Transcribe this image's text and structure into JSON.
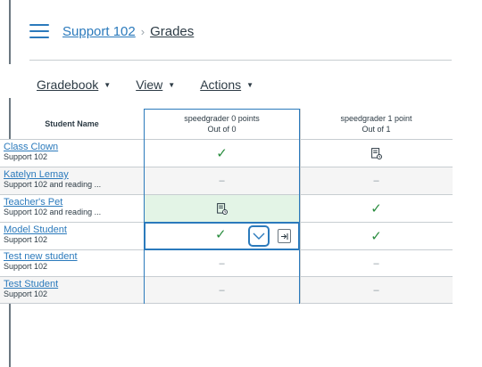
{
  "breadcrumb": {
    "course": "Support 102",
    "separator": "›",
    "current": "Grades"
  },
  "toolbar": {
    "menus": [
      {
        "label": "Gradebook",
        "caret": "▼"
      },
      {
        "label": "View",
        "caret": "▼"
      },
      {
        "label": "Actions",
        "caret": "▼"
      }
    ]
  },
  "grid": {
    "name_header": "Student Name",
    "columns": [
      {
        "title": "speedgrader 0 points",
        "subtitle": "Out of 0"
      },
      {
        "title": "speedgrader 1 point",
        "subtitle": "Out of 1"
      }
    ],
    "rows": [
      {
        "name": "Class Clown",
        "section": "Support 102",
        "grades": [
          "check",
          "pending"
        ]
      },
      {
        "name": "Katelyn Lemay",
        "section": "Support 102 and reading ...",
        "grades": [
          "dash",
          "dash"
        ]
      },
      {
        "name": "Teacher's Pet",
        "section": "Support 102 and reading ...",
        "grades": [
          "pending",
          "check"
        ]
      },
      {
        "name": "Model Student",
        "section": "Support 102",
        "grades": [
          "check",
          "check"
        ]
      },
      {
        "name": "Test new student",
        "section": "Support 102",
        "grades": [
          "dash",
          "dash"
        ]
      },
      {
        "name": "Test Student",
        "section": "Support 102",
        "grades": [
          "dash",
          "dash"
        ]
      }
    ],
    "symbols": {
      "check": "✓",
      "dash": "–"
    }
  },
  "colors": {
    "link": "#2b7abc",
    "check": "#2a8d3f",
    "row_stripe": "#f5f5f5",
    "highlight": "#e3f4e6",
    "active_border": "#2b7abc"
  },
  "icons": {
    "menu": "hamburger-icon",
    "pending": "pending-review-icon",
    "grade_toggle": "chevron-down-icon",
    "open_tray": "open-tray-icon"
  }
}
